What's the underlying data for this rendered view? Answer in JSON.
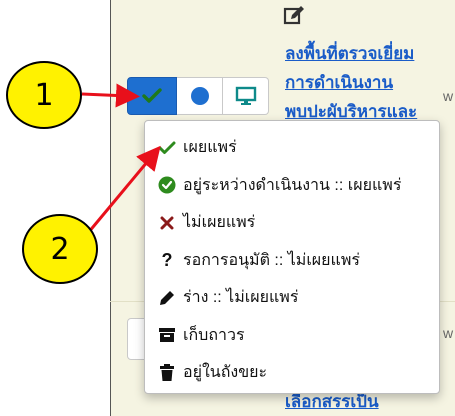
{
  "item": {
    "edit_icon": "pencil-square-icon",
    "title_lines": [
      "ลงพื้นที่ตรวจเยี่ยม",
      "การดำเนินงาน",
      "พบปะผับริหารและ"
    ],
    "bottom_title_partial": "เลือกสรรเป็น",
    "side_text_fragment": "w"
  },
  "toolbar": {
    "status_button_icon": "check-icon",
    "featured_button_icon": "circle-icon",
    "view_button_icon": "monitor-icon"
  },
  "status_menu": {
    "items": [
      {
        "label": "เผยแพร่",
        "icon": "check-icon",
        "color": "#2e8b1e"
      },
      {
        "label": "อยู่ระหว่างดำเนินงาน :: เผยแพร่",
        "icon": "check-circle-icon",
        "color": "#2e8b1e"
      },
      {
        "label": "ไม่เผยแพร่",
        "icon": "times-icon",
        "color": "#8b1a1a"
      },
      {
        "label": "รอการอนุมัติ :: ไม่เผยแพร่",
        "icon": "question-icon",
        "color": "#111111"
      },
      {
        "label": "ร่าง :: ไม่เผยแพร่",
        "icon": "pencil-icon",
        "color": "#111111"
      },
      {
        "label": "เก็บถาวร",
        "icon": "archive-icon",
        "color": "#111111"
      },
      {
        "label": "อยู่ในถังขยะ",
        "icon": "trash-icon",
        "color": "#111111"
      }
    ]
  },
  "annotations": {
    "callout_1": "1",
    "callout_2": "2",
    "arrow_color": "#e8101b",
    "callout_fill": "#fff200"
  },
  "colors": {
    "panel_background": "#f5f4e2",
    "primary_blue": "#1e6fd0",
    "link_blue": "#1a5cc8"
  }
}
